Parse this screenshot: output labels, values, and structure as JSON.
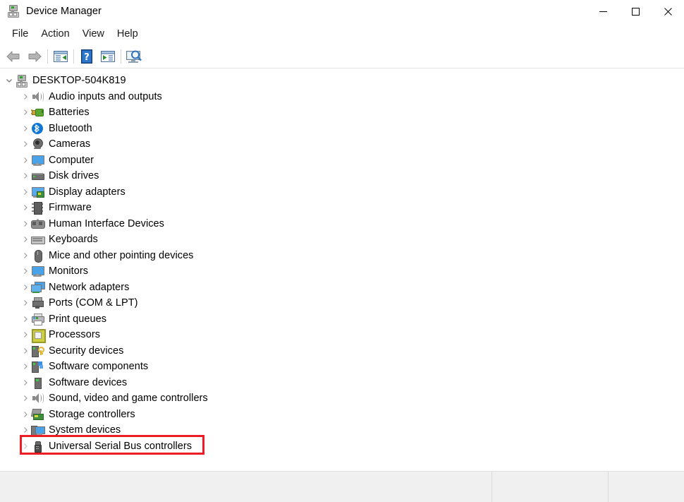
{
  "window": {
    "title": "Device Manager",
    "icon": "device-manager-icon",
    "controls": {
      "minimize": "—",
      "maximize": "☐",
      "close": "✕"
    }
  },
  "menubar": {
    "items": [
      {
        "label": "File",
        "name": "menu-file"
      },
      {
        "label": "Action",
        "name": "menu-action"
      },
      {
        "label": "View",
        "name": "menu-view"
      },
      {
        "label": "Help",
        "name": "menu-help"
      }
    ]
  },
  "toolbar": {
    "buttons": [
      {
        "name": "back-button",
        "icon": "back-arrow-icon",
        "tooltip": "Back"
      },
      {
        "name": "forward-button",
        "icon": "forward-arrow-icon",
        "tooltip": "Forward"
      },
      {
        "name": "show-hide-console-tree-button",
        "icon": "console-tree-icon",
        "tooltip": "Show/Hide Console Tree"
      },
      {
        "name": "help-button",
        "icon": "help-question-icon",
        "tooltip": "Help"
      },
      {
        "name": "properties-button",
        "icon": "properties-icon",
        "tooltip": "Properties"
      },
      {
        "name": "scan-hardware-changes-button",
        "icon": "scan-hardware-icon",
        "tooltip": "Scan for hardware changes"
      }
    ]
  },
  "tree": {
    "root": {
      "label": "DESKTOP-504K819",
      "icon": "computer-root-icon",
      "chevron": "expanded",
      "expanded": true
    },
    "items": [
      {
        "label": "Audio inputs and outputs",
        "icon": "speaker-icon",
        "chevron": "collapsed"
      },
      {
        "label": "Batteries",
        "icon": "battery-icon",
        "chevron": "collapsed"
      },
      {
        "label": "Bluetooth",
        "icon": "bluetooth-icon",
        "chevron": "collapsed"
      },
      {
        "label": "Cameras",
        "icon": "camera-icon",
        "chevron": "collapsed"
      },
      {
        "label": "Computer",
        "icon": "monitor-icon",
        "chevron": "collapsed"
      },
      {
        "label": "Disk drives",
        "icon": "disk-drive-icon",
        "chevron": "collapsed"
      },
      {
        "label": "Display adapters",
        "icon": "display-adapter-icon",
        "chevron": "collapsed"
      },
      {
        "label": "Firmware",
        "icon": "firmware-chip-icon",
        "chevron": "collapsed"
      },
      {
        "label": "Human Interface Devices",
        "icon": "hid-icon",
        "chevron": "collapsed"
      },
      {
        "label": "Keyboards",
        "icon": "keyboard-icon",
        "chevron": "collapsed"
      },
      {
        "label": "Mice and other pointing devices",
        "icon": "mouse-icon",
        "chevron": "collapsed"
      },
      {
        "label": "Monitors",
        "icon": "monitor-icon",
        "chevron": "collapsed"
      },
      {
        "label": "Network adapters",
        "icon": "network-adapter-icon",
        "chevron": "collapsed"
      },
      {
        "label": "Ports (COM & LPT)",
        "icon": "port-icon",
        "chevron": "collapsed"
      },
      {
        "label": "Print queues",
        "icon": "printer-icon",
        "chevron": "collapsed"
      },
      {
        "label": "Processors",
        "icon": "processor-icon",
        "chevron": "collapsed"
      },
      {
        "label": "Security devices",
        "icon": "security-device-icon",
        "chevron": "collapsed"
      },
      {
        "label": "Software components",
        "icon": "software-component-icon",
        "chevron": "collapsed"
      },
      {
        "label": "Software devices",
        "icon": "software-device-icon",
        "chevron": "collapsed"
      },
      {
        "label": "Sound, video and game controllers",
        "icon": "speaker-icon",
        "chevron": "collapsed"
      },
      {
        "label": "Storage controllers",
        "icon": "storage-controller-icon",
        "chevron": "collapsed"
      },
      {
        "label": "System devices",
        "icon": "system-device-icon",
        "chevron": "collapsed"
      },
      {
        "label": "Universal Serial Bus controllers",
        "icon": "usb-icon",
        "chevron": "collapsed"
      }
    ],
    "chevron_glyphs": {
      "collapsed": "›",
      "expanded": "⌄"
    }
  },
  "annotation": {
    "highlight_target": "Universal Serial Bus controllers",
    "color": "#ee1c25"
  },
  "statusbar": {
    "panes": [
      "",
      "",
      ""
    ]
  },
  "colors": {
    "window_bg": "#ffffff",
    "statusbar_bg": "#f0f0f0",
    "text": "#000000",
    "highlight": "#ee1c25",
    "bluetooth_blue": "#0e77d6"
  }
}
